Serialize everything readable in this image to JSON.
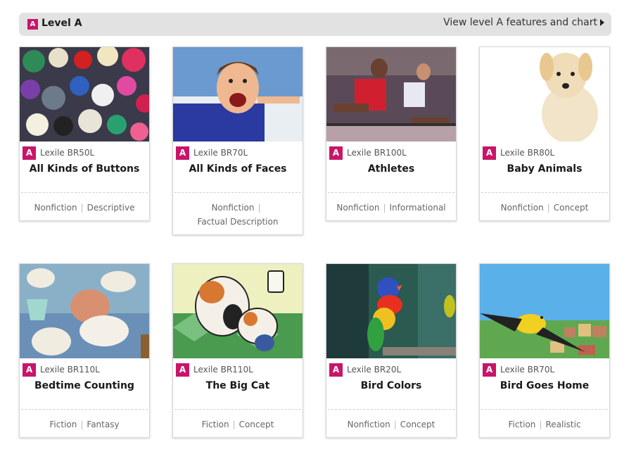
{
  "header": {
    "badge": "A",
    "title": "Level A",
    "link": "View level A features and chart"
  },
  "cards": [
    {
      "badge": "A",
      "lexile": "Lexile BR50L",
      "title": "All Kinds of Buttons",
      "genre": "Nonfiction",
      "type": "Descriptive"
    },
    {
      "badge": "A",
      "lexile": "Lexile BR70L",
      "title": "All Kinds of Faces",
      "genre": "Nonfiction",
      "type": "Factual Description"
    },
    {
      "badge": "A",
      "lexile": "Lexile BR100L",
      "title": "Athletes",
      "genre": "Nonfiction",
      "type": "Informational"
    },
    {
      "badge": "A",
      "lexile": "Lexile BR80L",
      "title": "Baby Animals",
      "genre": "Nonfiction",
      "type": "Concept"
    },
    {
      "badge": "A",
      "lexile": "Lexile BR110L",
      "title": "Bedtime Counting",
      "genre": "Fiction",
      "type": "Fantasy"
    },
    {
      "badge": "A",
      "lexile": "Lexile BR110L",
      "title": "The Big Cat",
      "genre": "Fiction",
      "type": "Concept"
    },
    {
      "badge": "A",
      "lexile": "Lexile BR20L",
      "title": "Bird Colors",
      "genre": "Nonfiction",
      "type": "Concept"
    },
    {
      "badge": "A",
      "lexile": "Lexile BR70L",
      "title": "Bird Goes Home",
      "genre": "Fiction",
      "type": "Realistic"
    }
  ],
  "colors": {
    "badge": "#c8156a",
    "header_bg": "#e2e2e2"
  }
}
